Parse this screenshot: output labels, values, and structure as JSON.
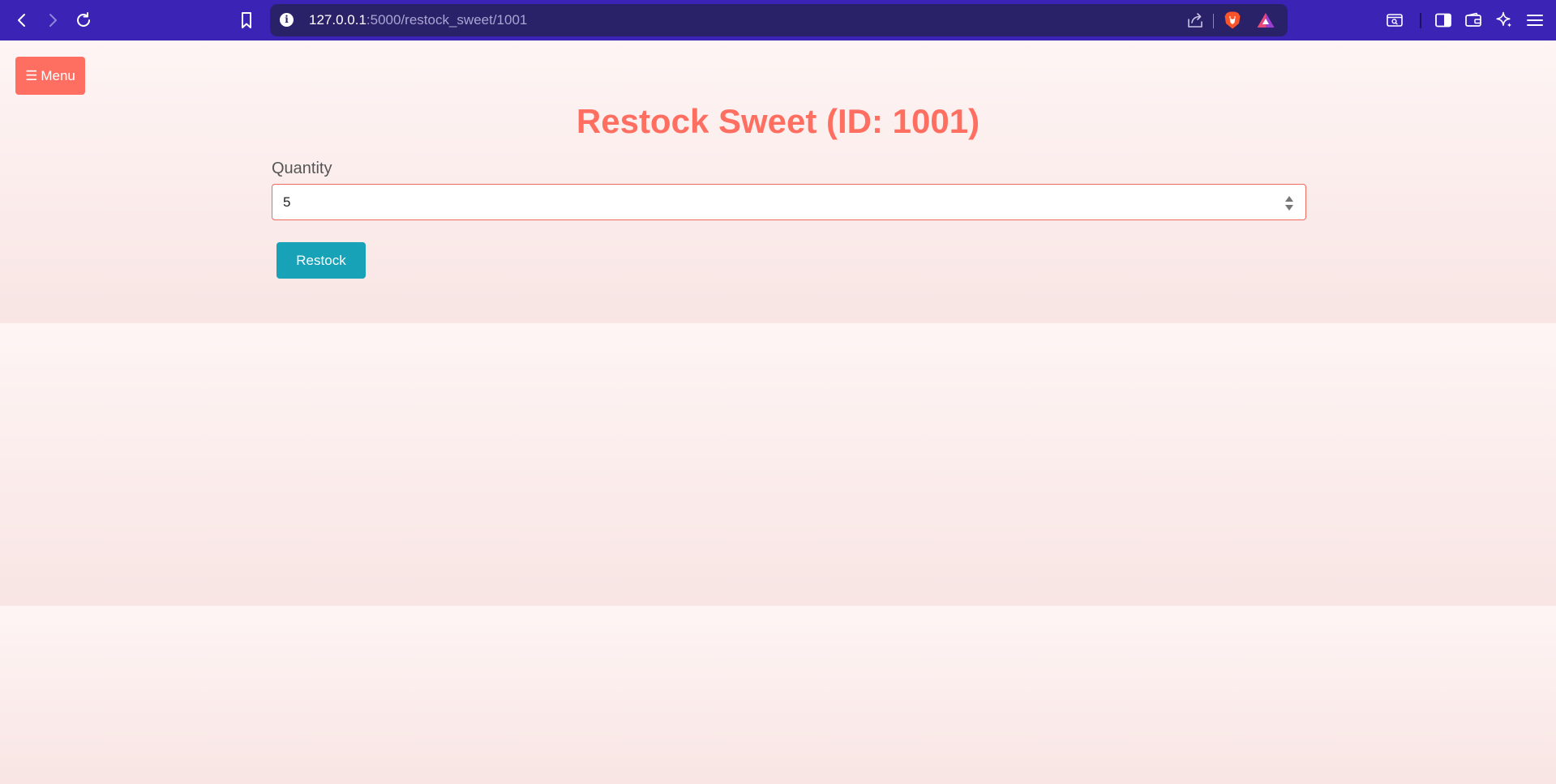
{
  "browser": {
    "url_host": "127.0.0.1",
    "url_rest": ":5000/restock_sweet/1001",
    "icons": {
      "back": "arrow-left-icon",
      "forward": "arrow-right-icon",
      "reload": "reload-icon",
      "bookmark": "bookmark-icon",
      "site_info": "info-icon",
      "share": "share-icon",
      "brave_shields": "brave-lion-icon",
      "brave_rewards": "brave-rewards-icon",
      "tab_search": "tab-search-icon",
      "sidebar": "sidebar-icon",
      "wallet": "wallet-icon",
      "leo": "leo-ai-icon",
      "menu": "hamburger-menu-icon"
    },
    "colors": {
      "toolbar": "#3a23b5",
      "address_bar": "#2a2268"
    }
  },
  "page": {
    "menu_button": {
      "glyph": "☰",
      "label": "Menu"
    },
    "title": "Restock Sweet (ID: 1001)",
    "form": {
      "quantity_label": "Quantity",
      "quantity_value": "5",
      "submit_label": "Restock"
    },
    "colors": {
      "accent": "#fe6f62",
      "button": "#17a2b8",
      "background": "#fdf3f2"
    }
  }
}
